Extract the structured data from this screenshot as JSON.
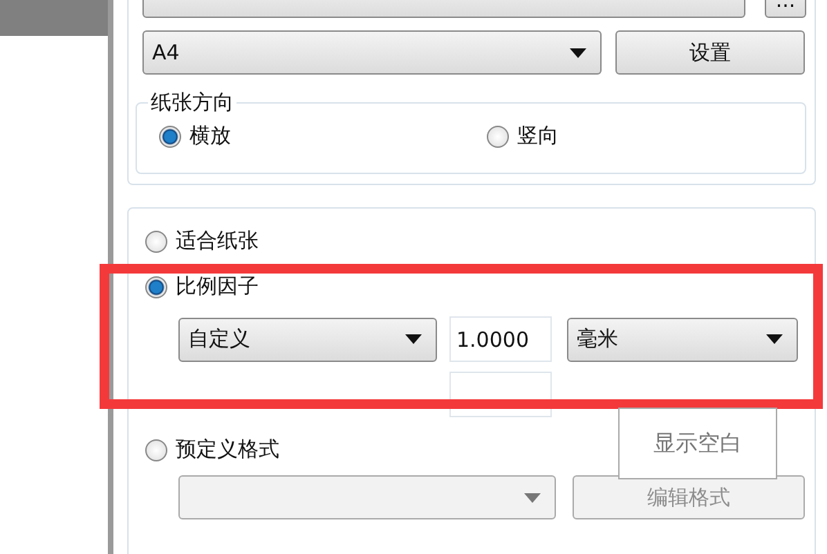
{
  "printer": {
    "more_button": "..."
  },
  "paper": {
    "value": "A4",
    "settings_button": "设置"
  },
  "orientation": {
    "legend": "纸张方向",
    "options": [
      {
        "label": "横放",
        "selected": true
      },
      {
        "label": "竖向",
        "selected": false
      }
    ]
  },
  "scaling": {
    "options": [
      {
        "label": "适合纸张",
        "selected": false
      },
      {
        "label": "比例因子",
        "selected": true
      },
      {
        "label": "预定义格式",
        "selected": false
      }
    ],
    "factor_unit": "自定义",
    "factor_value": "1.0000",
    "length_unit": "毫米",
    "format_dropdown": {
      "disabled": true
    },
    "edit_format_button": {
      "label": "编辑格式",
      "disabled": true
    }
  },
  "tooltip": "显示空白"
}
